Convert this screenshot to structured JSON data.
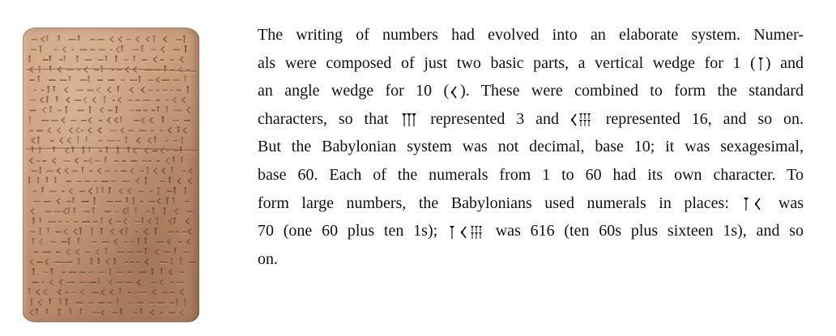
{
  "passage": {
    "lines": [
      {
        "parts": [
          {
            "t": "The writing of numbers had evolved into an elaborate system. Numer-"
          }
        ]
      },
      {
        "parts": [
          {
            "t": "als were composed of just two basic parts, a vertical wedge for 1 ("
          },
          {
            "g": "wedge-vertical"
          },
          {
            "t": ") and"
          }
        ]
      },
      {
        "parts": [
          {
            "t": "an angle wedge for 10 ("
          },
          {
            "g": "wedge-angle"
          },
          {
            "t": "). These were combined to form the standard"
          }
        ]
      },
      {
        "parts": [
          {
            "t": "characters, so that "
          },
          {
            "g": "numeral-3"
          },
          {
            "t": " represented 3 and "
          },
          {
            "g": "numeral-16"
          },
          {
            "t": " represented 16, and so on."
          }
        ]
      },
      {
        "parts": [
          {
            "t": "But the Babylonian system was not decimal, base 10; it was sexagesimal,"
          }
        ]
      },
      {
        "parts": [
          {
            "t": "base 60. Each of the numerals from 1 to 60 had its own character. To"
          }
        ]
      },
      {
        "parts": [
          {
            "t": "form large numbers, the Babylonians used numerals in places: "
          },
          {
            "g": "numeral-70"
          },
          {
            "t": " was"
          }
        ]
      },
      {
        "parts": [
          {
            "t": "70 (one 60 plus ten 1s); "
          },
          {
            "g": "numeral-616"
          },
          {
            "t": " was 616 (ten 60s plus sixteen 1s), and so"
          }
        ]
      },
      {
        "parts": [
          {
            "t": "on."
          }
        ]
      }
    ]
  },
  "glyph_names": {
    "wedge-vertical": "vertical-wedge-icon",
    "wedge-angle": "angle-wedge-icon",
    "numeral-3": "cuneiform-3-icon",
    "numeral-16": "cuneiform-16-icon",
    "numeral-70": "cuneiform-70-icon",
    "numeral-616": "cuneiform-616-icon"
  },
  "colors": {
    "text": "#111111",
    "clay": "#c09274",
    "clay_shadow": "#8a5e44"
  }
}
